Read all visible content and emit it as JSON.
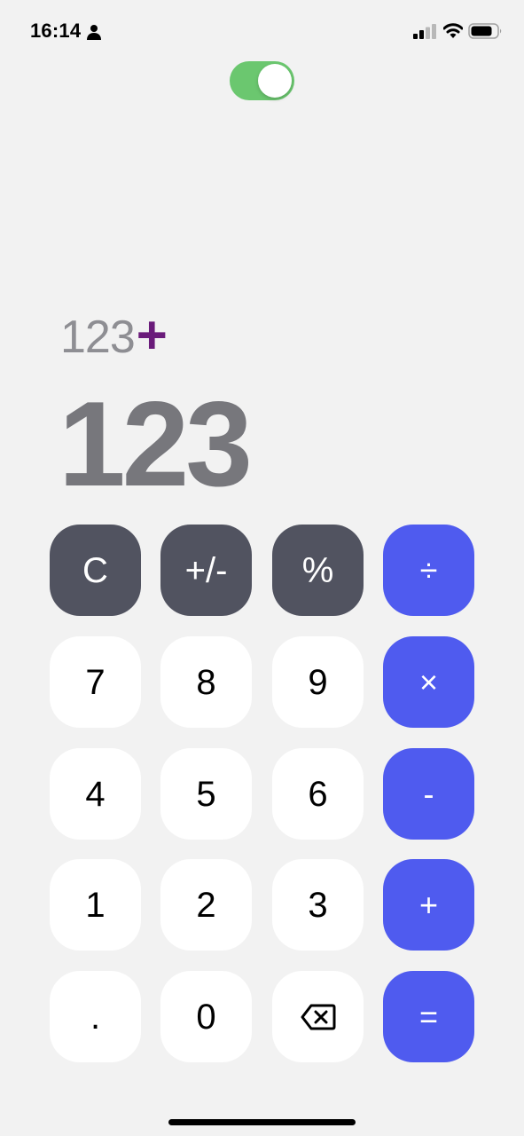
{
  "status_bar": {
    "time": "16:14"
  },
  "mode_toggle": {
    "on": true,
    "color": "#6bc76f"
  },
  "display": {
    "expression_operand": "123",
    "expression_operator": "+",
    "result": "123",
    "operator_color": "#6a1b7a"
  },
  "keypad": {
    "row1": {
      "clear": "C",
      "sign": "+/-",
      "percent": "%",
      "divide": "÷"
    },
    "row2": {
      "seven": "7",
      "eight": "8",
      "nine": "9",
      "multiply": "×"
    },
    "row3": {
      "four": "4",
      "five": "5",
      "six": "6",
      "minus": "-"
    },
    "row4": {
      "one": "1",
      "two": "2",
      "three": "3",
      "plus": "+"
    },
    "row5": {
      "decimal": ".",
      "zero": "0",
      "backspace_icon": "backspace-icon",
      "equals": "="
    }
  },
  "colors": {
    "background": "#f2f2f2",
    "function_key": "#515360",
    "operator_key": "#4f5bef",
    "digit_key": "#ffffff"
  }
}
